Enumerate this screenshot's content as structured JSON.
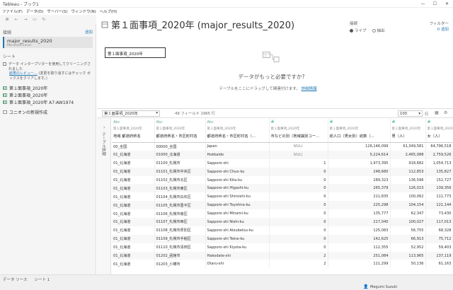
{
  "window": {
    "title": "Tableau - ブック1",
    "controls": [
      "—",
      "☐",
      "✕"
    ]
  },
  "menu": [
    "ファイル(F)",
    "データ(D)",
    "サーバー(S)",
    "ウィンドウ(N)",
    "ヘルプ(H)"
  ],
  "toolbar": [
    "⊞",
    "←",
    "→",
    "▭",
    "↻"
  ],
  "left": {
    "conn_header": "接続",
    "conn_add": "追加",
    "connection": {
      "name": "major_results_2020",
      "sub": "Microsoft Excel"
    },
    "sheet_header": "シート",
    "interpreter": "データ インタープリターを使用してクリーニングされました",
    "review_link": "結果のレビュー...",
    "review_note": "(変更を取り消すにはチェック ボックスをクリアします。)",
    "sheets": [
      "第１面事項_2020年",
      "第２面事項_2020年",
      "第１面事項_2020年 A7:AW1974"
    ],
    "union": "ユニオンの新規作成"
  },
  "canvas": {
    "title": "第１面事項_2020年 (major_results_2020)",
    "conn_label": "接続",
    "live": "ライブ",
    "extract": "抽出",
    "filter_label": "フィルター",
    "filter_value": "0 追加",
    "table_box": "第１面事項_2020年",
    "question": "データがもっと必要ですか?",
    "drag_note": "テーブルをここにドラッグして関連付けます。",
    "detail_link": "詳細情報"
  },
  "gridtool": {
    "table_select": "第１面事項_2020年",
    "field_count": "49 フィールド 1965 行",
    "rows_value": "100",
    "rows_label": "行"
  },
  "side": {
    "label": "テーブル詳細"
  },
  "grid": {
    "columns": [
      {
        "type": "Abc",
        "source": "第１面事項_2020年",
        "name": "地域 都道府県名"
      },
      {
        "type": "Abc",
        "source": "第１面事項_2020年",
        "name": "都道府県名・市区町村名"
      },
      {
        "type": "Abc",
        "source": "第１面事項_2020年",
        "name": "都道府県名・市区町村名（..."
      },
      {
        "type": "#",
        "source": "第１面事項_2020年",
        "name": "市などの別（地域識別コー..."
      },
      {
        "type": "#",
        "source": "第１面事項_2020年",
        "name": "総人口（男女別）総数（..."
      },
      {
        "type": "#",
        "source": "第１面事項_2020年",
        "name": "男（人）"
      },
      {
        "type": "#",
        "source": "第１面事項_2020年",
        "name": "女（人）"
      }
    ],
    "rows": [
      [
        "00_全国",
        "00000_全国",
        "Japan",
        "NULL",
        "126,146,099",
        "61,349,581",
        "64,796,518"
      ],
      [
        "01_北海道",
        "01000_北海道",
        "Hokkaido",
        "NULL",
        "5,224,614",
        "2,465,088",
        "2,759,526"
      ],
      [
        "01_北海道",
        "01100_札幌市",
        "Sapporo-shi",
        "1",
        "1,973,395",
        "918,682",
        "1,054,713"
      ],
      [
        "01_北海道",
        "01101_札幌市中央区",
        "Sapporo-shi Chuo-ku",
        "0",
        "248,680",
        "112,853",
        "135,827"
      ],
      [
        "01_北海道",
        "01102_札幌市北区",
        "Sapporo-shi Kita-ku",
        "0",
        "289,323",
        "136,596",
        "152,727"
      ],
      [
        "01_北海道",
        "01103_札幌市東区",
        "Sapporo-shi Higashi-ku",
        "0",
        "265,379",
        "126,023",
        "139,356"
      ],
      [
        "01_北海道",
        "01104_札幌市白石区",
        "Sapporo-shi Shiroishi-ku",
        "0",
        "211,835",
        "100,062",
        "111,773"
      ],
      [
        "01_北海道",
        "01105_札幌市豊平区",
        "Sapporo-shi Toyohira-ku",
        "0",
        "225,298",
        "104,154",
        "121,144"
      ],
      [
        "01_北海道",
        "01106_札幌市南区",
        "Sapporo-shi Minami-ku",
        "0",
        "135,777",
        "62,347",
        "73,430"
      ],
      [
        "01_北海道",
        "01107_札幌市西区",
        "Sapporo-shi Nishi-ku",
        "0",
        "217,040",
        "100,027",
        "117,013"
      ],
      [
        "01_北海道",
        "01108_札幌市厚別区",
        "Sapporo-shi Atsubetsu-ku",
        "0",
        "125,083",
        "56,755",
        "68,328"
      ],
      [
        "01_北海道",
        "01109_札幌市手稲区",
        "Sapporo-shi Teine-ku",
        "0",
        "142,625",
        "66,913",
        "75,712"
      ],
      [
        "01_北海道",
        "01110_札幌市清田区",
        "Sapporo-shi Kiyota-ku",
        "0",
        "112,355",
        "52,952",
        "59,403"
      ],
      [
        "01_北海道",
        "01202_函館市",
        "Hakodate-shi",
        "2",
        "251,084",
        "113,965",
        "137,119"
      ],
      [
        "01_北海道",
        "01203_小樽市",
        "Otaru-shi",
        "2",
        "111,299",
        "50,136",
        "61,163"
      ]
    ]
  },
  "status": {
    "tabs": [
      "データ ソース",
      "シート 1"
    ],
    "user": "Megumi Suzuki"
  }
}
